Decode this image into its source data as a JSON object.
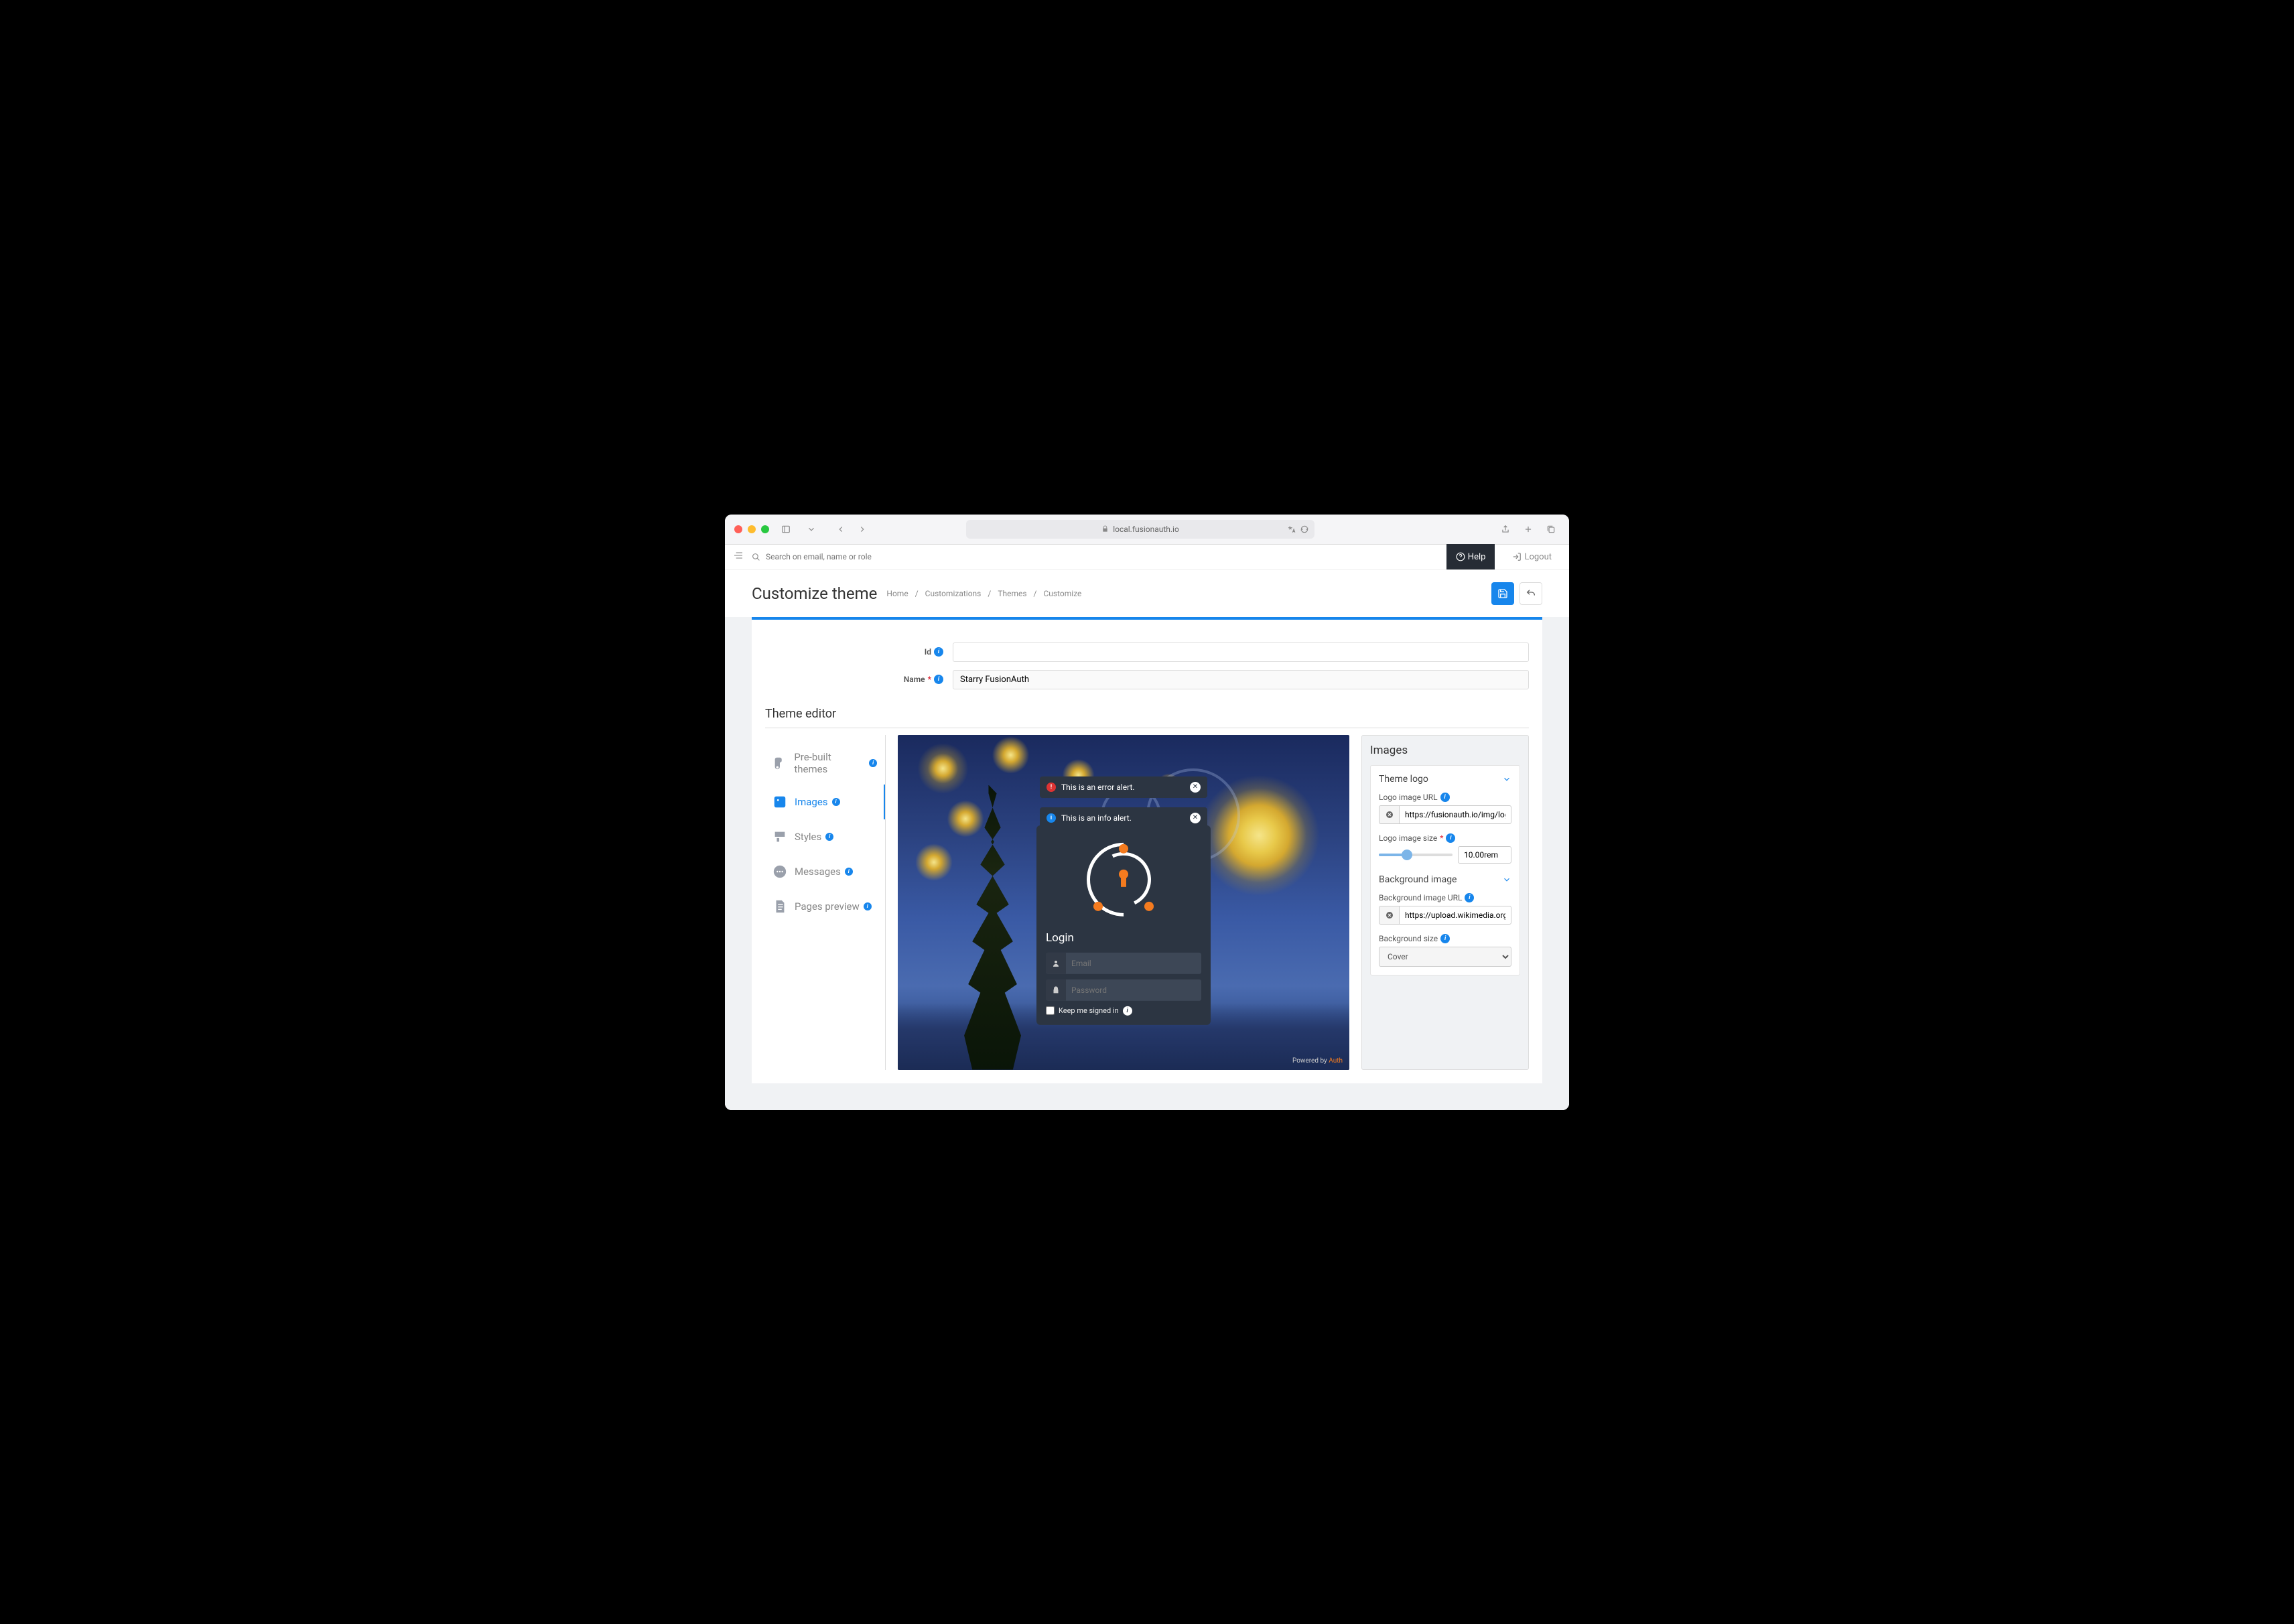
{
  "browser": {
    "url": "local.fusionauth.io"
  },
  "app_header": {
    "search_placeholder": "Search on email, name or role",
    "help": "Help",
    "logout": "Logout"
  },
  "page": {
    "title": "Customize theme",
    "breadcrumbs": [
      "Home",
      "Customizations",
      "Themes",
      "Customize"
    ]
  },
  "form": {
    "id_label": "Id",
    "id_value": "",
    "name_label": "Name",
    "name_value": "Starry FusionAuth"
  },
  "editor": {
    "title": "Theme editor",
    "tabs": [
      {
        "label": "Pre-built themes",
        "icon": "palette"
      },
      {
        "label": "Images",
        "icon": "image",
        "active": true
      },
      {
        "label": "Styles",
        "icon": "brush"
      },
      {
        "label": "Messages",
        "icon": "chat"
      },
      {
        "label": "Pages preview",
        "icon": "page"
      }
    ]
  },
  "preview": {
    "alerts": {
      "error": "This is an error alert.",
      "info": "This is an info alert."
    },
    "login": {
      "title": "Login",
      "email_placeholder": "Email",
      "password_placeholder": "Password",
      "keep_signed": "Keep me signed in"
    },
    "powered_prefix": "Powered by ",
    "powered_brand": "Auth"
  },
  "props": {
    "panel_title": "Images",
    "sections": {
      "logo": {
        "title": "Theme logo",
        "url_label": "Logo image URL",
        "url_value": "https://fusionauth.io/img/logo/fa_",
        "size_label": "Logo image size",
        "size_value": "10.00rem"
      },
      "bg": {
        "title": "Background image",
        "url_label": "Background image URL",
        "url_value": "https://upload.wikimedia.org/wiki",
        "size_label": "Background size",
        "size_value": "Cover"
      }
    }
  }
}
